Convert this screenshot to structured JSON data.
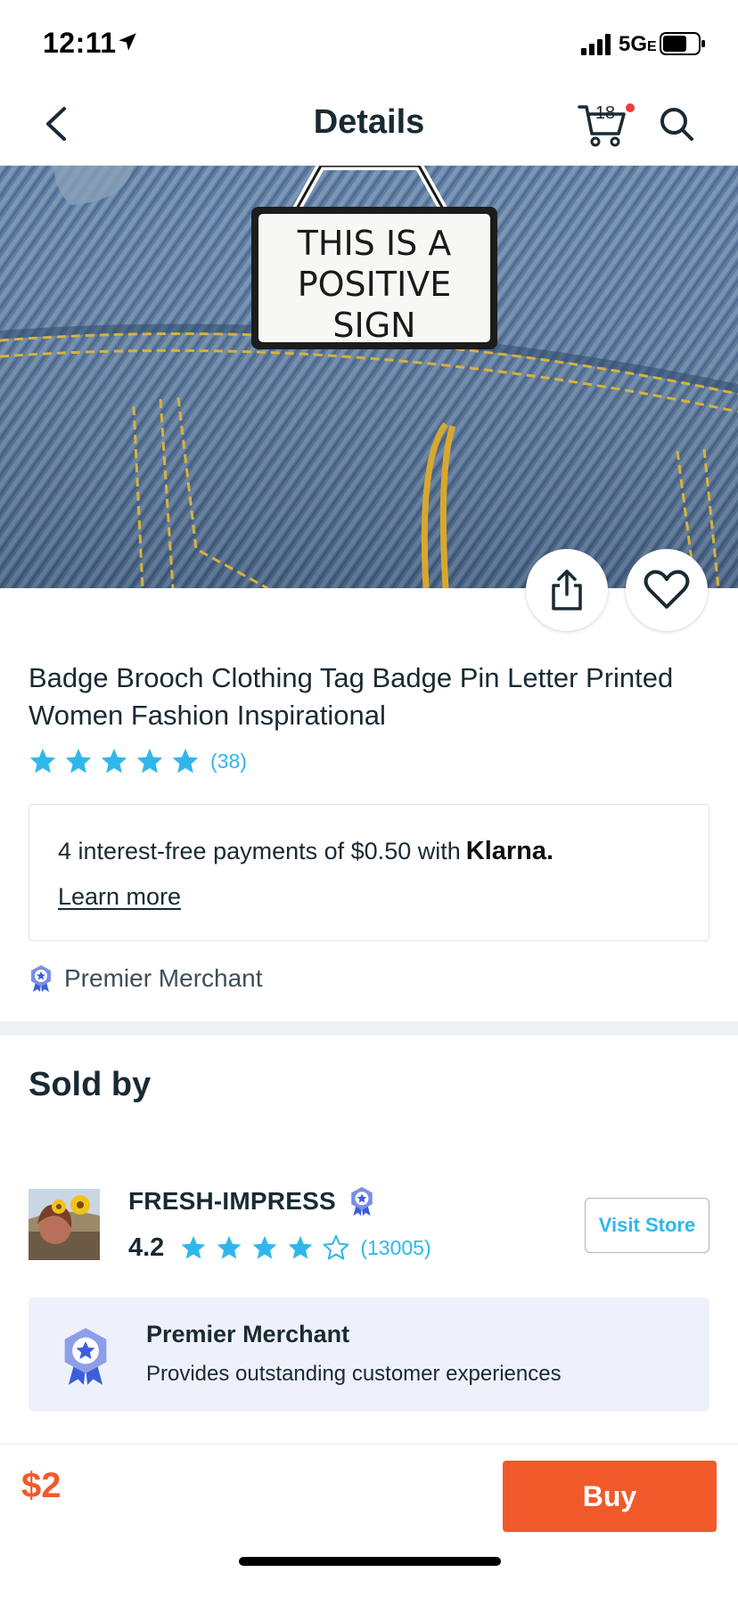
{
  "status_bar": {
    "time": "12:11",
    "network": "5G",
    "network_suffix": "E"
  },
  "nav": {
    "title": "Details",
    "cart_count": "18"
  },
  "hero": {
    "image_desc": "enamel pin on denim jacket",
    "sign_lines": [
      "THIS IS A",
      "POSITIVE",
      "SIGN"
    ]
  },
  "product": {
    "title": "Badge Brooch Clothing Tag Badge Pin Letter Printed Women Fashion Inspirational",
    "rating_stars": 5,
    "review_count": "(38)"
  },
  "klarna": {
    "text": "4 interest-free payments of $0.50 with",
    "brand": "Klarna.",
    "link": "Learn more"
  },
  "merchant_tag": {
    "label": "Premier Merchant"
  },
  "sold_by": {
    "heading": "Sold by",
    "store_name": "FRESH-IMPRESS",
    "score": "4.2",
    "review_count": "(13005)",
    "visit_label": "Visit Store"
  },
  "premier_card": {
    "title": "Premier Merchant",
    "description": "Provides outstanding customer experiences"
  },
  "bottom": {
    "price": "$2",
    "buy_label": "Buy"
  },
  "colors": {
    "accent": "#f1592a",
    "star": "#2fb7ec",
    "text": "#192a32"
  },
  "icons": [
    "location-arrow-icon",
    "signal-icon",
    "battery-icon",
    "back-icon",
    "cart-icon",
    "search-icon",
    "share-icon",
    "heart-icon",
    "star-icon",
    "premier-badge-icon"
  ]
}
